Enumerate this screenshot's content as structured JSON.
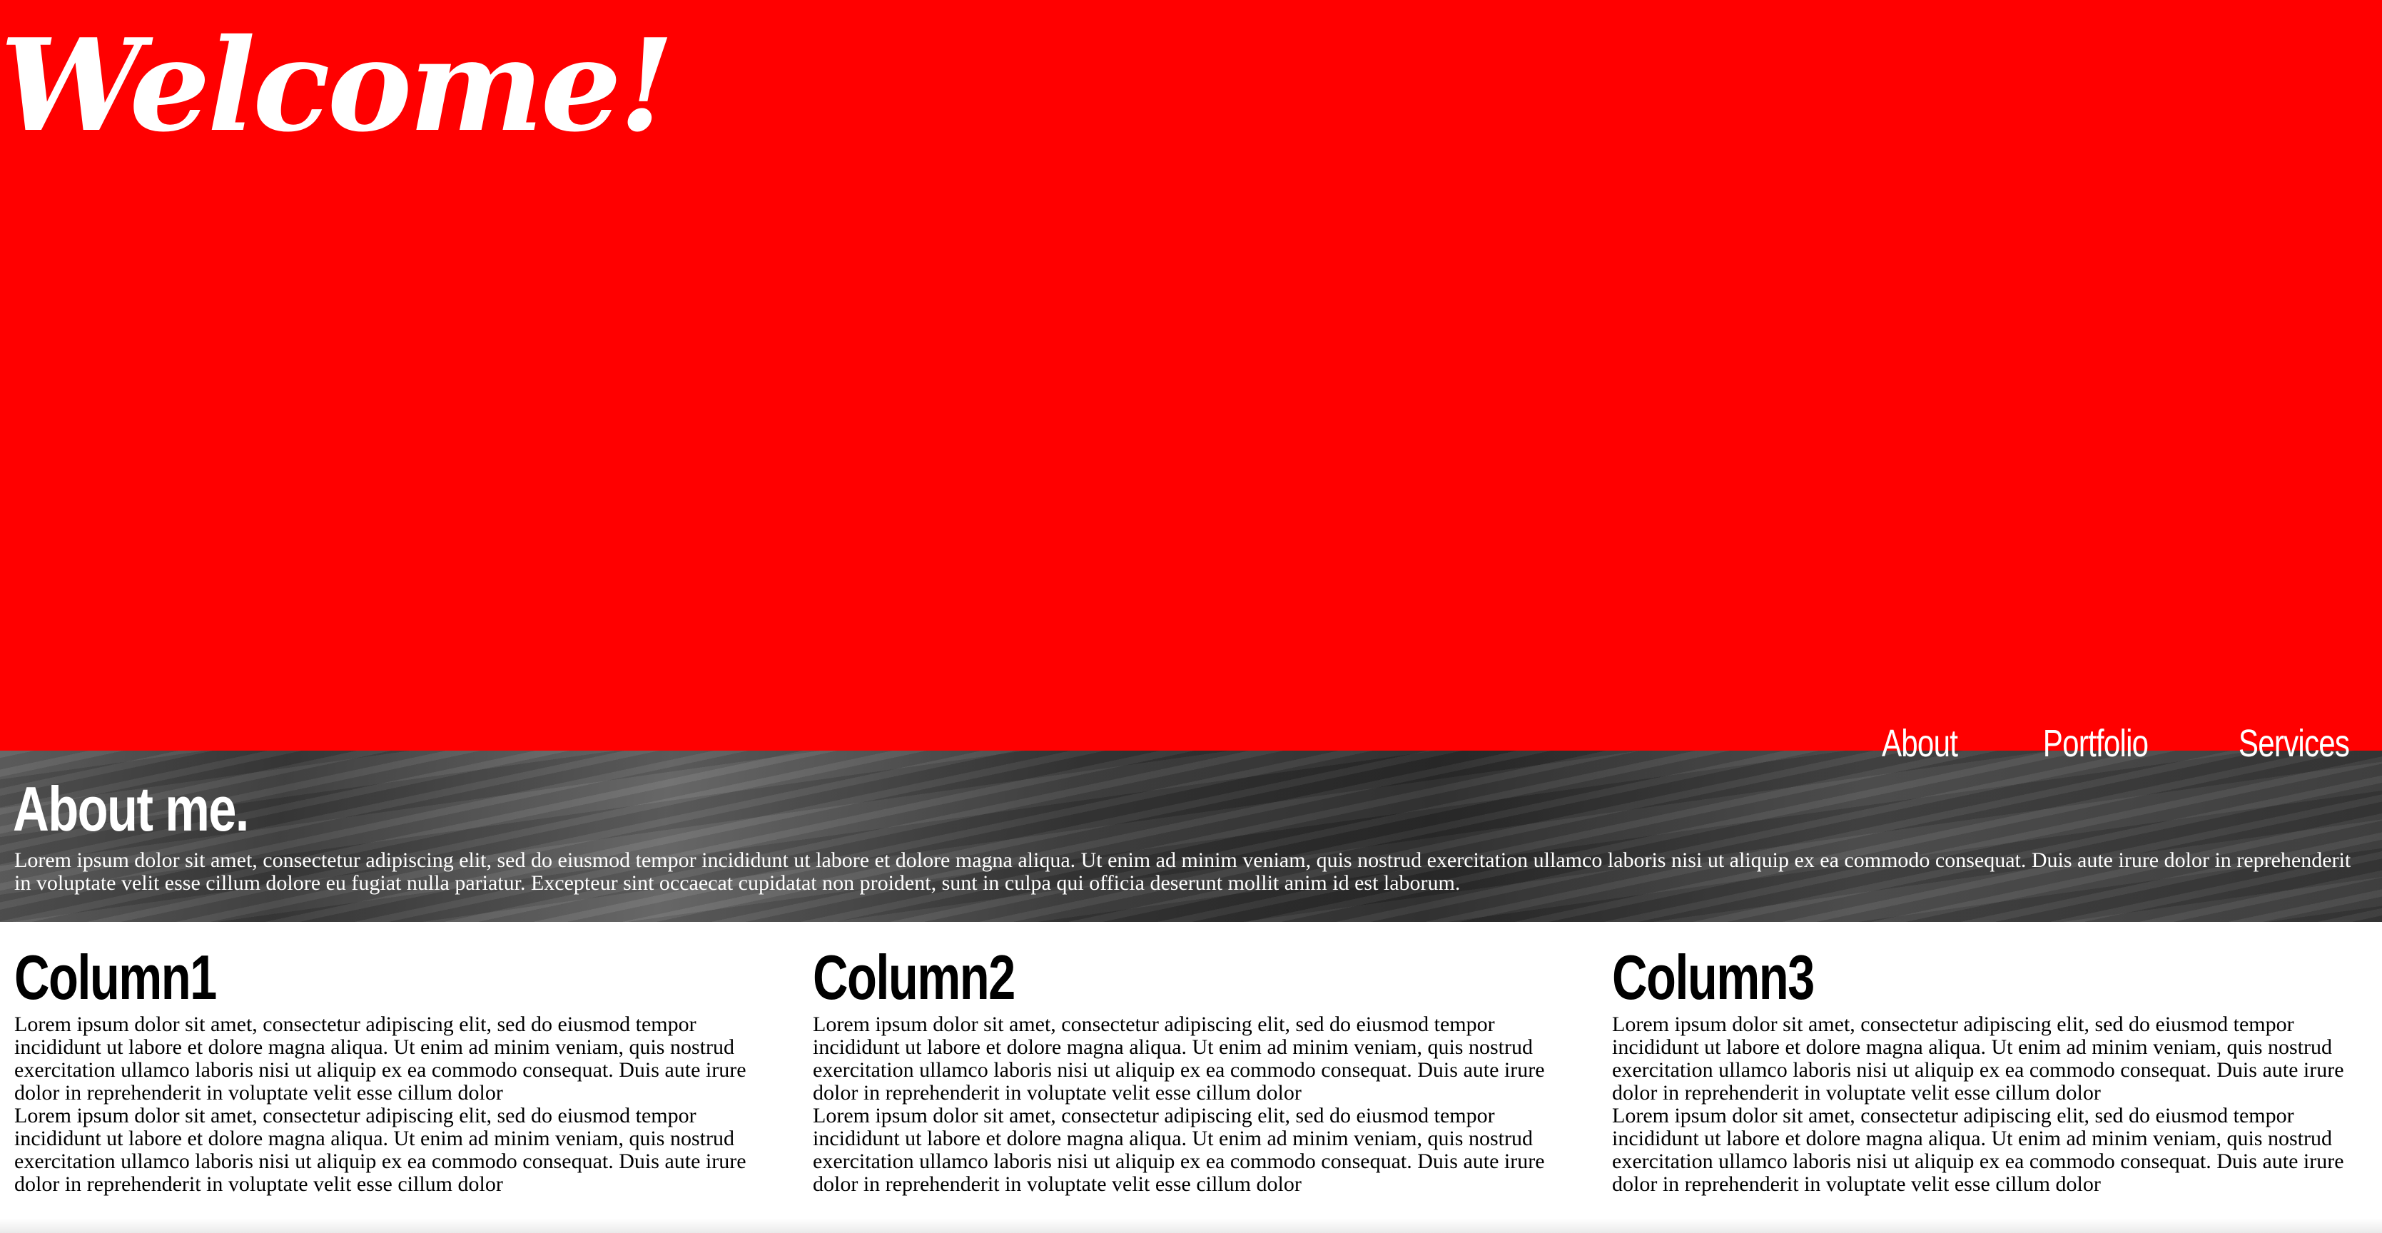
{
  "hero": {
    "title": "Welcome!",
    "background_color": "#ff0000"
  },
  "nav": {
    "items": [
      {
        "label": "About"
      },
      {
        "label": "Portfolio"
      },
      {
        "label": "Services"
      }
    ]
  },
  "about": {
    "heading": "About me.",
    "text": "Lorem ipsum dolor sit amet, consectetur adipiscing elit, sed do eiusmod tempor incididunt ut labore et dolore magna aliqua. Ut enim ad minim veniam, quis nostrud exercitation ullamco laboris nisi ut aliquip ex ea commodo consequat. Duis aute irure dolor in reprehenderit in voluptate velit esse cillum dolore eu fugiat nulla pariatur. Excepteur sint occaecat cupidatat non proident, sunt in culpa qui officia deserunt mollit anim id est laborum."
  },
  "columns": [
    {
      "title": "Column1",
      "paragraphs": [
        "Lorem ipsum dolor sit amet, consectetur adipiscing elit, sed do eiusmod tempor incididunt ut labore et dolore magna aliqua. Ut enim ad minim veniam, quis nostrud exercitation ullamco laboris nisi ut aliquip ex ea commodo consequat. Duis aute irure dolor in reprehenderit in voluptate velit esse cillum dolor",
        "Lorem ipsum dolor sit amet, consectetur adipiscing elit, sed do eiusmod tempor incididunt ut labore et dolore magna aliqua. Ut enim ad minim veniam, quis nostrud exercitation ullamco laboris nisi ut aliquip ex ea commodo consequat. Duis aute irure dolor in reprehenderit in voluptate velit esse cillum dolor"
      ]
    },
    {
      "title": "Column2",
      "paragraphs": [
        "Lorem ipsum dolor sit amet, consectetur adipiscing elit, sed do eiusmod tempor incididunt ut labore et dolore magna aliqua. Ut enim ad minim veniam, quis nostrud exercitation ullamco laboris nisi ut aliquip ex ea commodo consequat. Duis aute irure dolor in reprehenderit in voluptate velit esse cillum dolor",
        "Lorem ipsum dolor sit amet, consectetur adipiscing elit, sed do eiusmod tempor incididunt ut labore et dolore magna aliqua. Ut enim ad minim veniam, quis nostrud exercitation ullamco laboris nisi ut aliquip ex ea commodo consequat. Duis aute irure dolor in reprehenderit in voluptate velit esse cillum dolor"
      ]
    },
    {
      "title": "Column3",
      "paragraphs": [
        "Lorem ipsum dolor sit amet, consectetur adipiscing elit, sed do eiusmod tempor incididunt ut labore et dolore magna aliqua. Ut enim ad minim veniam, quis nostrud exercitation ullamco laboris nisi ut aliquip ex ea commodo consequat. Duis aute irure dolor in reprehenderit in voluptate velit esse cillum dolor",
        "Lorem ipsum dolor sit amet, consectetur adipiscing elit, sed do eiusmod tempor incididunt ut labore et dolore magna aliqua. Ut enim ad minim veniam, quis nostrud exercitation ullamco laboris nisi ut aliquip ex ea commodo consequat. Duis aute irure dolor in reprehenderit in voluptate velit esse cillum dolor"
      ]
    }
  ]
}
